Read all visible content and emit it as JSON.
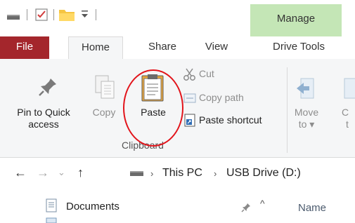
{
  "context_tab": {
    "label": "Manage"
  },
  "tabs": [
    {
      "label": "File"
    },
    {
      "label": "Home"
    },
    {
      "label": "Share"
    },
    {
      "label": "View"
    },
    {
      "label": "Drive Tools"
    }
  ],
  "ribbon": {
    "pin": {
      "label_line1": "Pin to Quick",
      "label_line2": "access"
    },
    "copy": {
      "label": "Copy"
    },
    "paste": {
      "label": "Paste"
    },
    "cut": {
      "label": "Cut"
    },
    "copy_path": {
      "label": "Copy path"
    },
    "paste_shortcut": {
      "label": "Paste shortcut"
    },
    "group_clipboard": {
      "label": "Clipboard"
    },
    "move_to": {
      "label_line1": "Move",
      "label_line2": "to ▾"
    },
    "copy_to_partial": {
      "label_line1": "C",
      "label_line2": "t"
    }
  },
  "address": {
    "crumbs": [
      {
        "label": "This PC"
      },
      {
        "label": "USB Drive (D:)"
      }
    ]
  },
  "nav_pane": {
    "items": [
      {
        "label": "Documents"
      }
    ]
  },
  "content": {
    "columns": [
      {
        "label": "Name"
      }
    ]
  },
  "colors": {
    "file_tab": "#a4262c",
    "manage_tab": "#c4e6b6",
    "highlight_circle": "#e2141b"
  }
}
